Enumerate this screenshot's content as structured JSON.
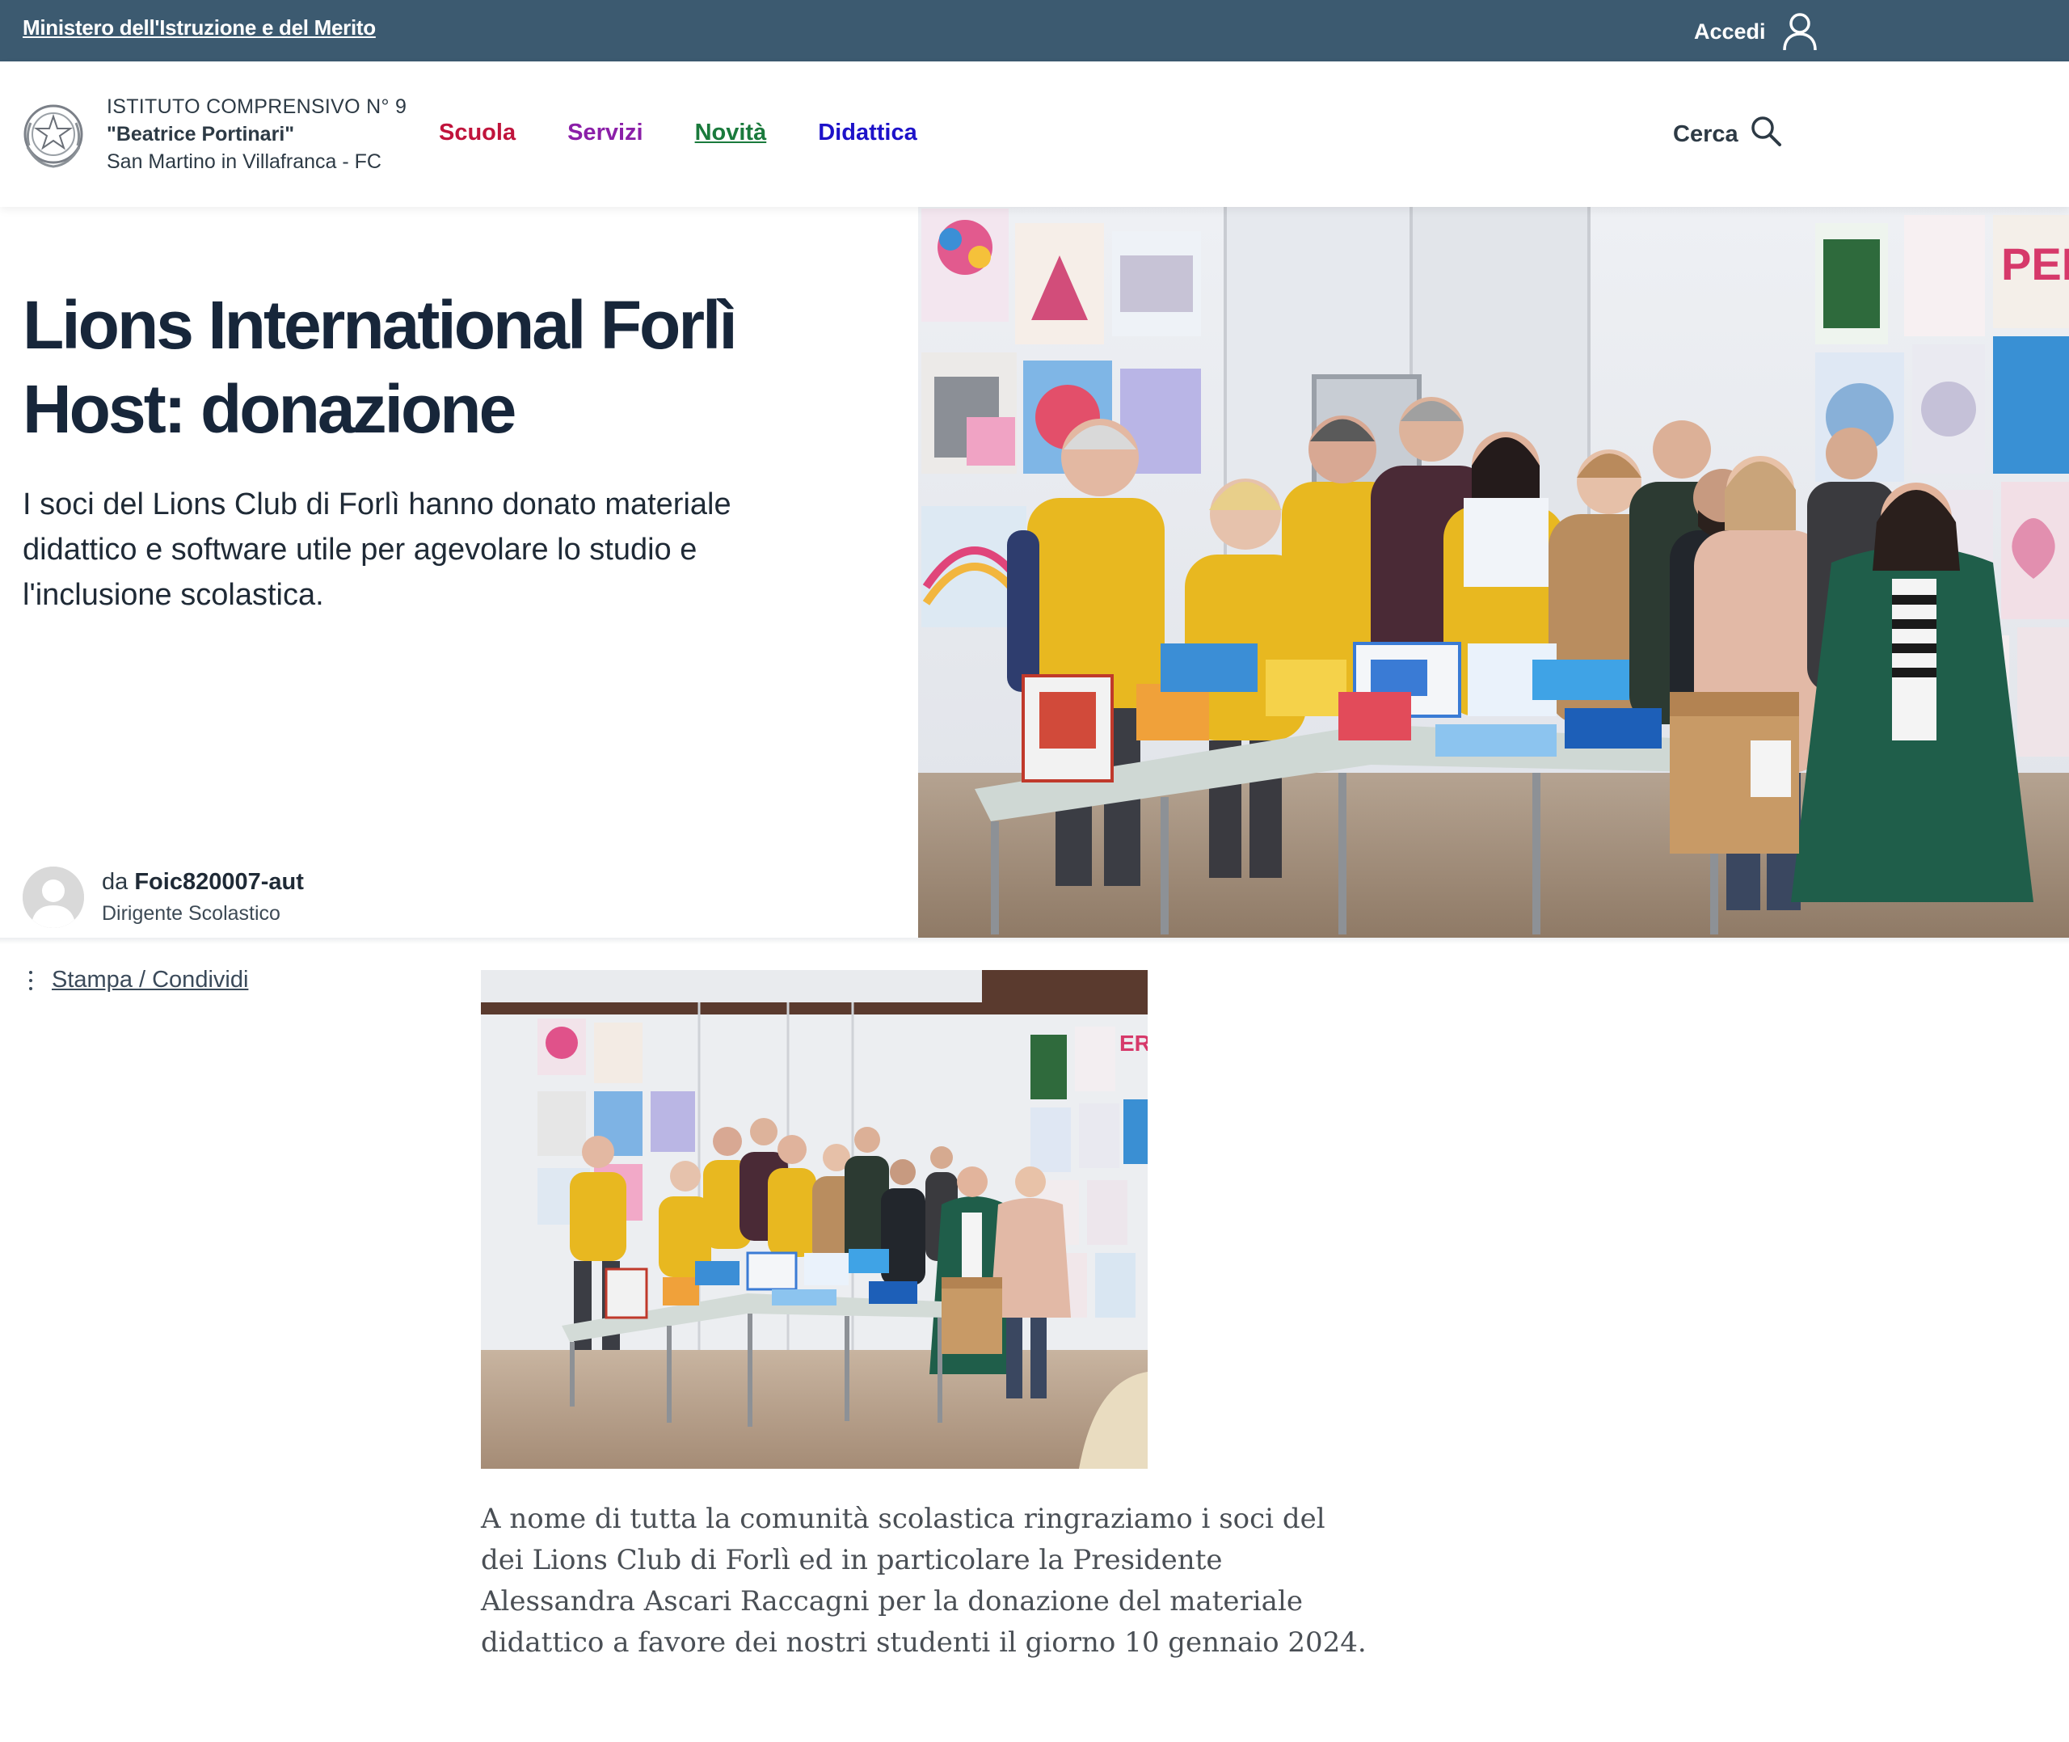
{
  "topbar": {
    "ministry": "Ministero dell'Istruzione e del Merito",
    "login_label": "Accedi"
  },
  "header": {
    "school_line1": "ISTITUTO COMPRENSIVO N° 9",
    "school_line2": "\"Beatrice Portinari\"",
    "school_line3": "San Martino in Villafranca - FC",
    "nav": [
      "Scuola",
      "Servizi",
      "Novità",
      "Didattica"
    ],
    "search_label": "Cerca"
  },
  "article": {
    "title": "Lions International Forlì Host: donazione",
    "description": "I soci del Lions Club di Forlì hanno donato materiale didattico e software utile per agevolare lo studio e l'inclusione scolastica.",
    "author_prefix": "da",
    "author_name": "Foic820007-aut",
    "author_role": "Dirigente Scolastico",
    "share_label": "Stampa / Condividi",
    "body": "A nome di tutta la comunità scolastica ringraziamo  i soci del  dei Lions Club di Forlì ed in particolare la Presidente Alessandra Ascari Raccagni per la donazione del  materiale didattico a favore dei nostri  studenti  il giorno 10 gennaio 2024."
  },
  "colors": {
    "topbar": "#3c5a70",
    "nav_scuola": "#c0143c",
    "nav_servizi": "#8b1fa8",
    "nav_novita": "#1a7a3c",
    "nav_didattica": "#1d12c9",
    "title": "#17263a"
  }
}
